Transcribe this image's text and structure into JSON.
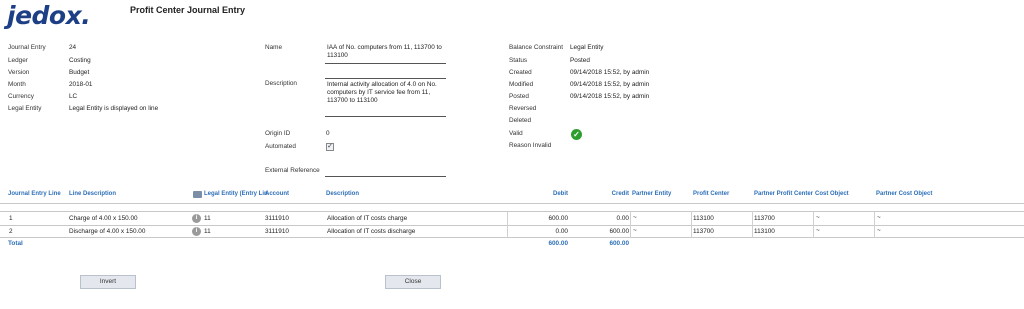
{
  "header": {
    "logo_text": "jedox.",
    "title": "Profit Center Journal Entry"
  },
  "left": {
    "fields": [
      {
        "label": "Journal Entry",
        "value": "24"
      },
      {
        "label": "Ledger",
        "value": "Costing"
      },
      {
        "label": "Version",
        "value": "Budget"
      },
      {
        "label": "Month",
        "value": "2018-01"
      },
      {
        "label": "Currency",
        "value": "LC"
      },
      {
        "label": "Legal Entity",
        "value": "Legal Entity is displayed on line"
      }
    ]
  },
  "middle": {
    "name_label": "Name",
    "name_value": "IAA of No. computers from 11, 113700 to 113100",
    "description_label": "Description",
    "description_value": "Internal activity allocation of 4.0 on No. computers by IT service fee from 11, 113700 to 113100",
    "origin_label": "Origin ID",
    "origin_value": "0",
    "automated_label": "Automated",
    "automated_check": "✓",
    "external_label": "External Reference",
    "external_value": ""
  },
  "right": {
    "balance_label": "Balance Constraint",
    "balance_value": "Legal Entity",
    "status_label": "Status",
    "status_value": "Posted",
    "created_label": "Created",
    "created_value": "09/14/2018 15:52, by admin",
    "modified_label": "Modified",
    "modified_value": "09/14/2018 15:52, by admin",
    "posted_label": "Posted",
    "posted_value": "09/14/2018 15:52, by admin",
    "reversed_label": "Reversed",
    "deleted_label": "Deleted",
    "valid_label": "Valid",
    "valid_icon": "✓",
    "reason_label": "Reason Invalid"
  },
  "table": {
    "headers": {
      "line": "Journal Entry Line",
      "line_desc": "Line Description",
      "legal_entity": "Legal Entity (Entry Lin",
      "account": "Account",
      "description": "Description",
      "debit": "Debit",
      "credit": "Credit",
      "partner_entity": "Partner Entity",
      "profit_center": "Profit Center",
      "partner_profit_center": "Partner Profit Center",
      "cost_object": "Cost Object",
      "partner_cost_object": "Partner Cost Object"
    },
    "rows": [
      {
        "line": "1",
        "line_desc": "Charge of 4.00 x 150.00",
        "info": "i",
        "legal_entity": "11",
        "account": "3111910",
        "description": "Allocation of IT costs charge",
        "debit": "600.00",
        "credit": "0.00",
        "partner_entity": "~",
        "profit_center": "113100",
        "partner_profit_center": "113700",
        "cost_object": "~",
        "partner_cost_object": "~"
      },
      {
        "line": "2",
        "line_desc": "Discharge of 4.00 x 150.00",
        "info": "i",
        "legal_entity": "11",
        "account": "3111910",
        "description": "Allocation of IT costs discharge",
        "debit": "0.00",
        "credit": "600.00",
        "partner_entity": "~",
        "profit_center": "113700",
        "partner_profit_center": "113100",
        "cost_object": "~",
        "partner_cost_object": "~"
      }
    ],
    "total": {
      "label": "Total",
      "debit": "600.00",
      "credit": "600.00"
    }
  },
  "buttons": {
    "invert": "Invert",
    "close": "Close"
  },
  "colors": {
    "accent": "#2e6fb7",
    "logo": "#1d3f86",
    "valid": "#2e9e2e"
  }
}
